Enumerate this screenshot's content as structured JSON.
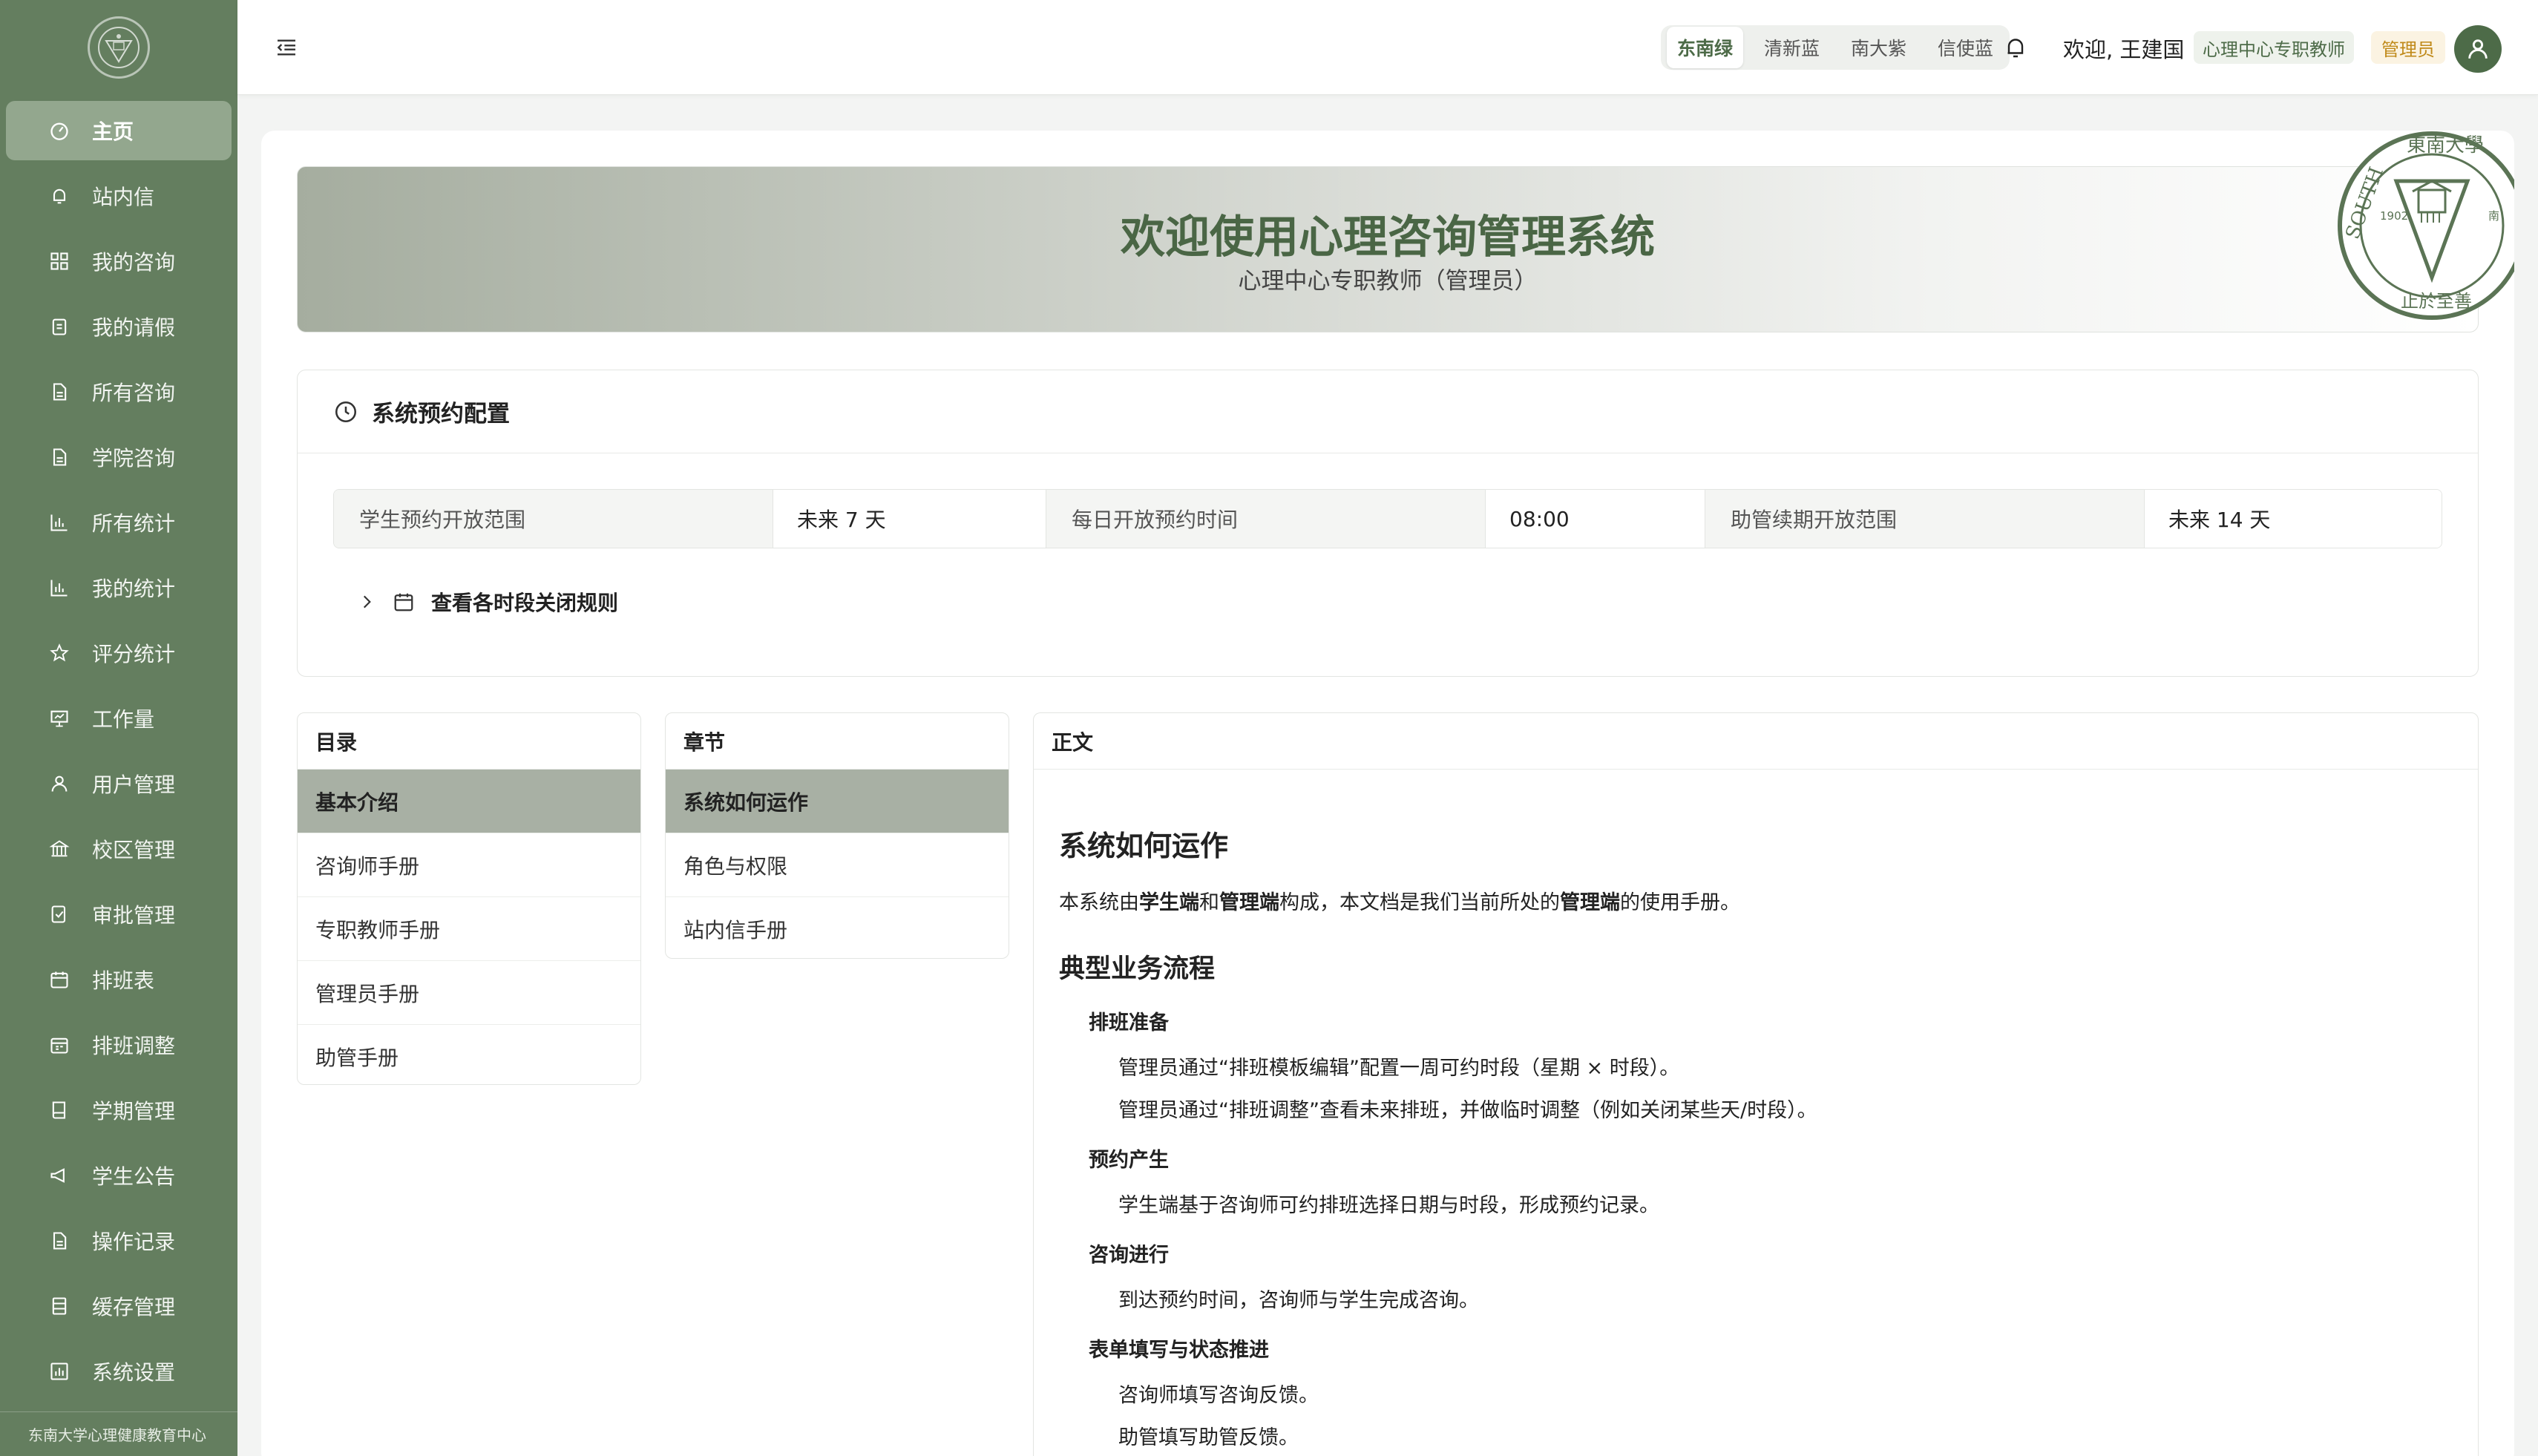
{
  "sidebar": {
    "footer": "东南大学心理健康教育中心",
    "items": [
      {
        "label": "主页",
        "icon": "dashboard-icon"
      },
      {
        "label": "站内信",
        "icon": "bell-icon"
      },
      {
        "label": "我的咨询",
        "icon": "grid-icon"
      },
      {
        "label": "我的请假",
        "icon": "leave-icon"
      },
      {
        "label": "所有咨询",
        "icon": "document-icon"
      },
      {
        "label": "学院咨询",
        "icon": "document-icon"
      },
      {
        "label": "所有统计",
        "icon": "bar-chart-icon"
      },
      {
        "label": "我的统计",
        "icon": "bar-chart-icon"
      },
      {
        "label": "评分统计",
        "icon": "star-icon"
      },
      {
        "label": "工作量",
        "icon": "presentation-icon"
      },
      {
        "label": "用户管理",
        "icon": "user-icon"
      },
      {
        "label": "校区管理",
        "icon": "building-icon"
      },
      {
        "label": "审批管理",
        "icon": "approval-icon"
      },
      {
        "label": "排班表",
        "icon": "calendar-icon"
      },
      {
        "label": "排班调整",
        "icon": "calendar-edit-icon"
      },
      {
        "label": "学期管理",
        "icon": "book-icon"
      },
      {
        "label": "学生公告",
        "icon": "megaphone-icon"
      },
      {
        "label": "操作记录",
        "icon": "document-icon"
      },
      {
        "label": "缓存管理",
        "icon": "database-icon"
      },
      {
        "label": "系统设置",
        "icon": "settings-chart-icon"
      }
    ]
  },
  "header": {
    "themes": [
      "东南绿",
      "清新蓝",
      "南大紫",
      "信使蓝"
    ],
    "welcome": "欢迎, 王建国",
    "role": "心理中心专职教师",
    "admin": "管理员"
  },
  "banner": {
    "title": "欢迎使用心理咨询管理系统",
    "subtitle": "心理中心专职教师（管理员）",
    "seal_text_top": "東南大學",
    "seal_text_left": "SOUTH",
    "seal_year": "1902",
    "seal_side": "南",
    "seal_bottom": "止於至善"
  },
  "config": {
    "title": "系统预约配置",
    "fields": [
      {
        "label": "学生预约开放范围",
        "value": "未来 7 天"
      },
      {
        "label": "每日开放预约时间",
        "value": "08:00"
      },
      {
        "label": "助管续期开放范围",
        "value": "未来 14 天"
      }
    ],
    "rules_toggle": "查看各时段关闭规则"
  },
  "toc": {
    "title": "目录",
    "items": [
      "基本介绍",
      "咨询师手册",
      "专职教师手册",
      "管理员手册",
      "助管手册"
    ]
  },
  "chapters": {
    "title": "章节",
    "items": [
      "系统如何运作",
      "角色与权限",
      "站内信手册"
    ]
  },
  "content": {
    "title": "正文",
    "h1": "系统如何运作",
    "intro": {
      "t1": "本系统由",
      "b1": "学生端",
      "t2": "和",
      "b2": "管理端",
      "t3": "构成，本文档是我们当前所处的",
      "b3": "管理端",
      "t4": "的使用手册。"
    },
    "h2": "典型业务流程",
    "sections": [
      {
        "title": "排班准备",
        "lines": [
          "管理员通过“排班模板编辑”配置一周可约时段（星期 × 时段）。",
          "管理员通过“排班调整”查看未来排班，并做临时调整（例如关闭某些天/时段）。"
        ]
      },
      {
        "title": "预约产生",
        "lines": [
          "学生端基于咨询师可约排班选择日期与时段，形成预约记录。"
        ]
      },
      {
        "title": "咨询进行",
        "lines": [
          "到达预约时间，咨询师与学生完成咨询。"
        ]
      },
      {
        "title": "表单填写与状态推进",
        "lines": [
          "咨询师填写咨询反馈。",
          "助管填写助管反馈。"
        ]
      }
    ]
  },
  "colors": {
    "sidebar": "#647e5f",
    "accent": "#4d6b48",
    "active_item": "#93a78e"
  }
}
